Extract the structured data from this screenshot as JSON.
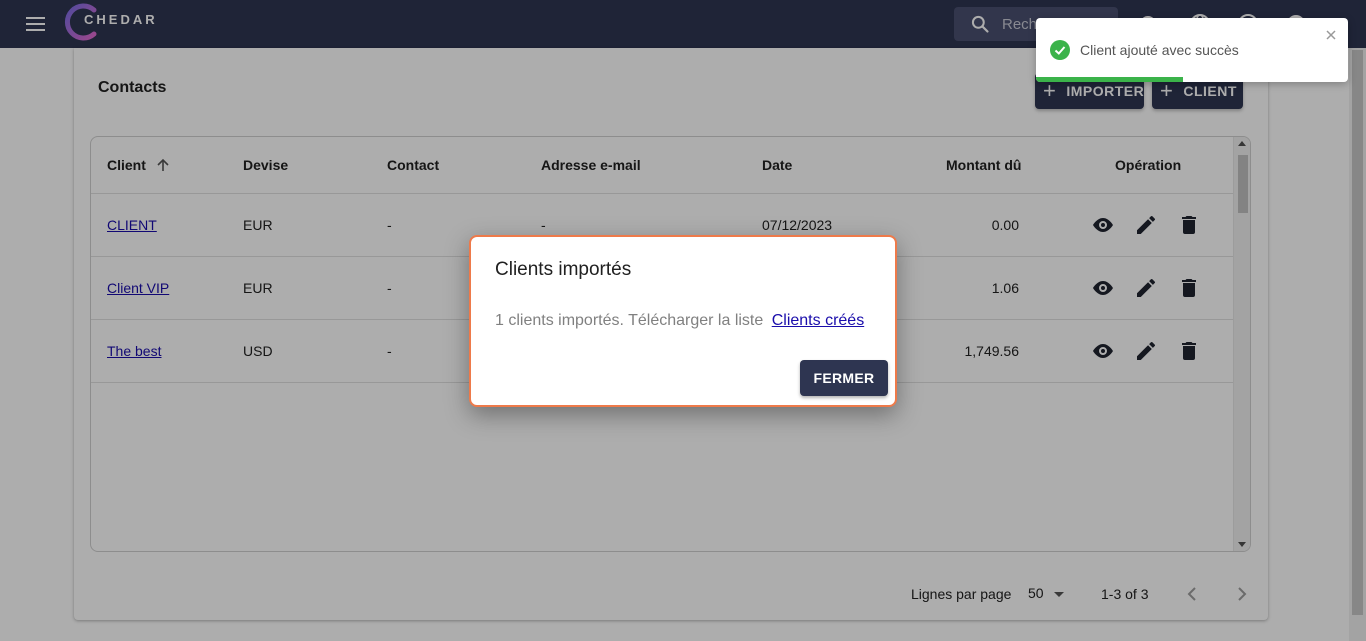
{
  "app": {
    "brand": "CHEDAR",
    "search_placeholder": "Rechercher"
  },
  "card": {
    "title": "Contacts",
    "import_button": "IMPORTER",
    "client_button": "CLIENT"
  },
  "table": {
    "headers": {
      "client": "Client",
      "devise": "Devise",
      "contact": "Contact",
      "email": "Adresse e-mail",
      "date": "Date",
      "montant": "Montant dû",
      "operation": "Opération"
    },
    "rows": [
      {
        "client": "CLIENT",
        "devise": "EUR",
        "contact": "-",
        "email": "-",
        "date": "07/12/2023",
        "montant": "0.00"
      },
      {
        "client": "Client VIP",
        "devise": "EUR",
        "contact": "-",
        "email": "",
        "date": "",
        "montant": "1.06"
      },
      {
        "client": "The best",
        "devise": "USD",
        "contact": "-",
        "email": "",
        "date": "",
        "montant": "1,749.56"
      }
    ]
  },
  "pagination": {
    "rows_per_page_label": "Lignes par page",
    "rows_per_page_value": "50",
    "range": "1-3 of 3"
  },
  "dialog": {
    "title": "Clients importés",
    "body": "1 clients importés. Télécharger la liste",
    "link": "Clients créés",
    "close_button": "FERMER"
  },
  "toast": {
    "message": "Client ajouté avec succès",
    "progress": 0.47
  },
  "colors": {
    "navy": "#2e3551",
    "accent_border": "#ee7a4a",
    "success": "#3bb34a",
    "link": "#1a0dab"
  }
}
